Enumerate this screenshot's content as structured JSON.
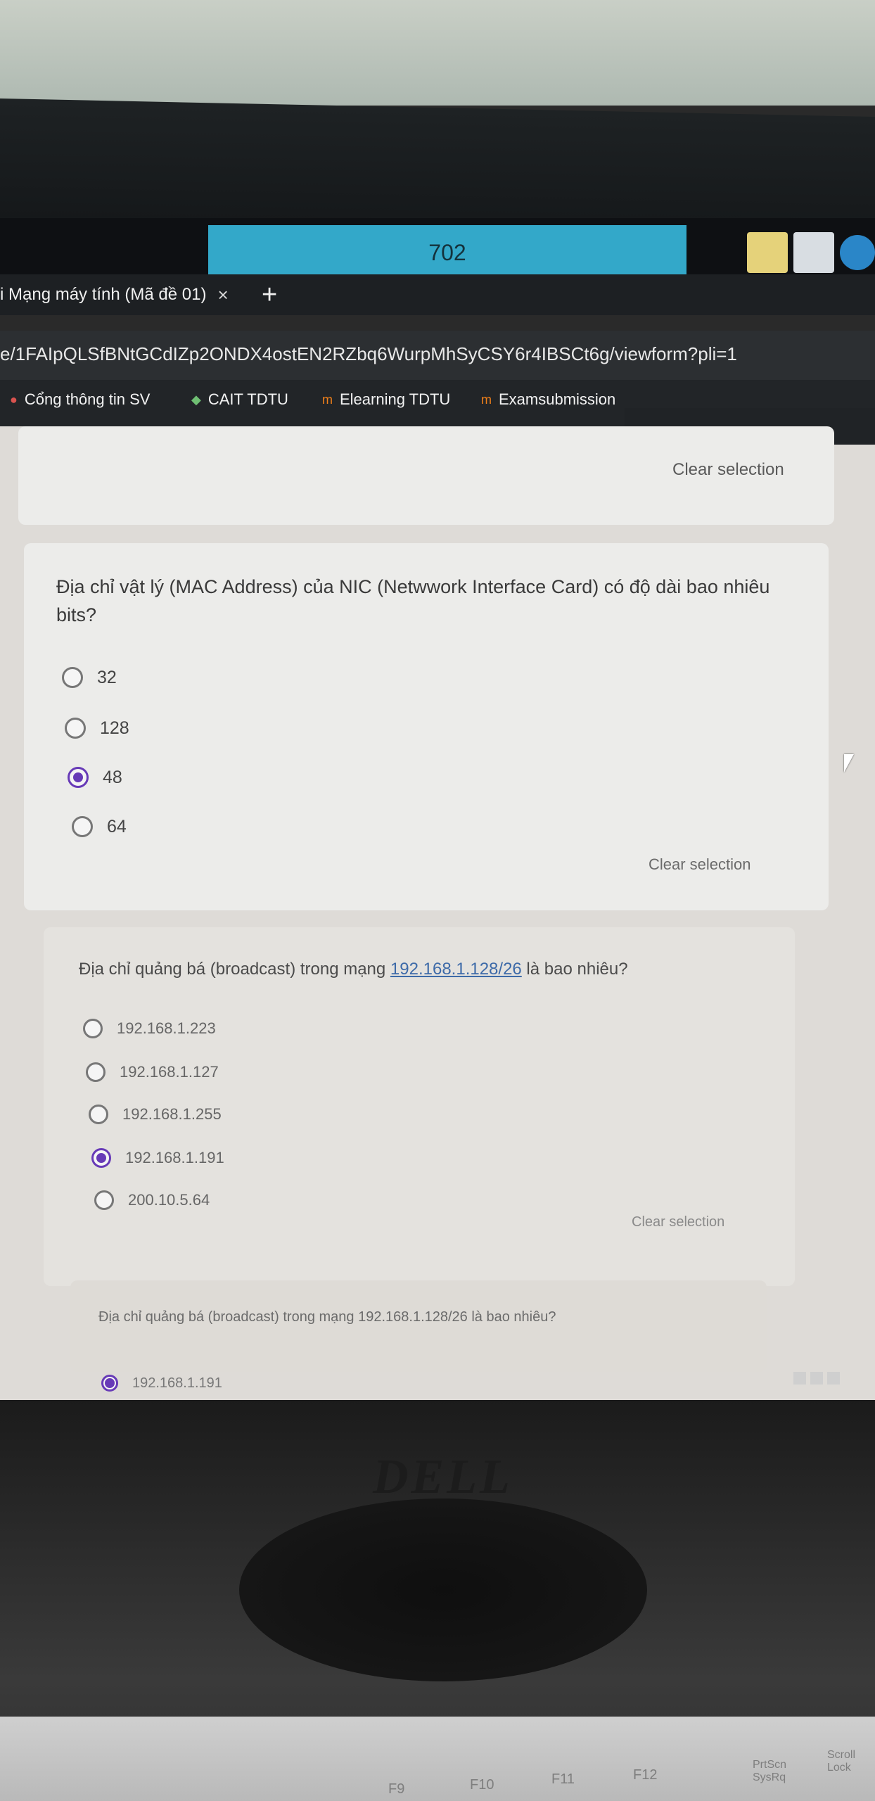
{
  "os": {
    "pc_number": "702"
  },
  "browser": {
    "tab_title": "i Mạng máy tính (Mã đề 01)",
    "tab_close": "×",
    "new_tab": "+",
    "url": "e/1FAIpQLSfBNtGCdIZp2ONDX4ostEN2RZbq6WurpMhSyCSY6r4IBSCt6g/viewform?pli=1",
    "bookmarks": [
      {
        "label": "Cổng thông tin SV",
        "icon": "portal-icon"
      },
      {
        "label": "CAIT TDTU",
        "icon": "cait-icon"
      },
      {
        "label": "Elearning TDTU",
        "icon": "moodle-icon"
      },
      {
        "label": "Examsubmission",
        "icon": "moodle-icon"
      }
    ]
  },
  "form": {
    "top_clear": "Clear selection",
    "q1": {
      "text": "Địa chỉ vật lý (MAC Address) của NIC (Netwwork Interface Card) có độ dài bao nhiêu bits?",
      "options": [
        "32",
        "128",
        "48",
        "64"
      ],
      "selected": "48",
      "clear": "Clear selection"
    },
    "q2": {
      "text_before": "Địa chỉ quảng bá (broadcast) trong mạng ",
      "link": "192.168.1.128/26",
      "text_after": " là bao nhiêu?",
      "options": [
        "192.168.1.223",
        "192.168.1.127",
        "192.168.1.255",
        "192.168.1.191",
        "200.10.5.64"
      ],
      "selected": "192.168.1.191",
      "clear": "Clear selection"
    },
    "q3": {
      "text": "Địa chỉ quảng bá (broadcast) trong mạng 192.168.1.128/26 là bao nhiêu?",
      "visible_option": "192.168.1.191"
    }
  },
  "hardware": {
    "brand": "DELL",
    "fkeys": [
      "F9",
      "F10",
      "F11",
      "F12"
    ],
    "prtscn": "PrtScn SysRq",
    "scroll": "Scroll Lock"
  }
}
